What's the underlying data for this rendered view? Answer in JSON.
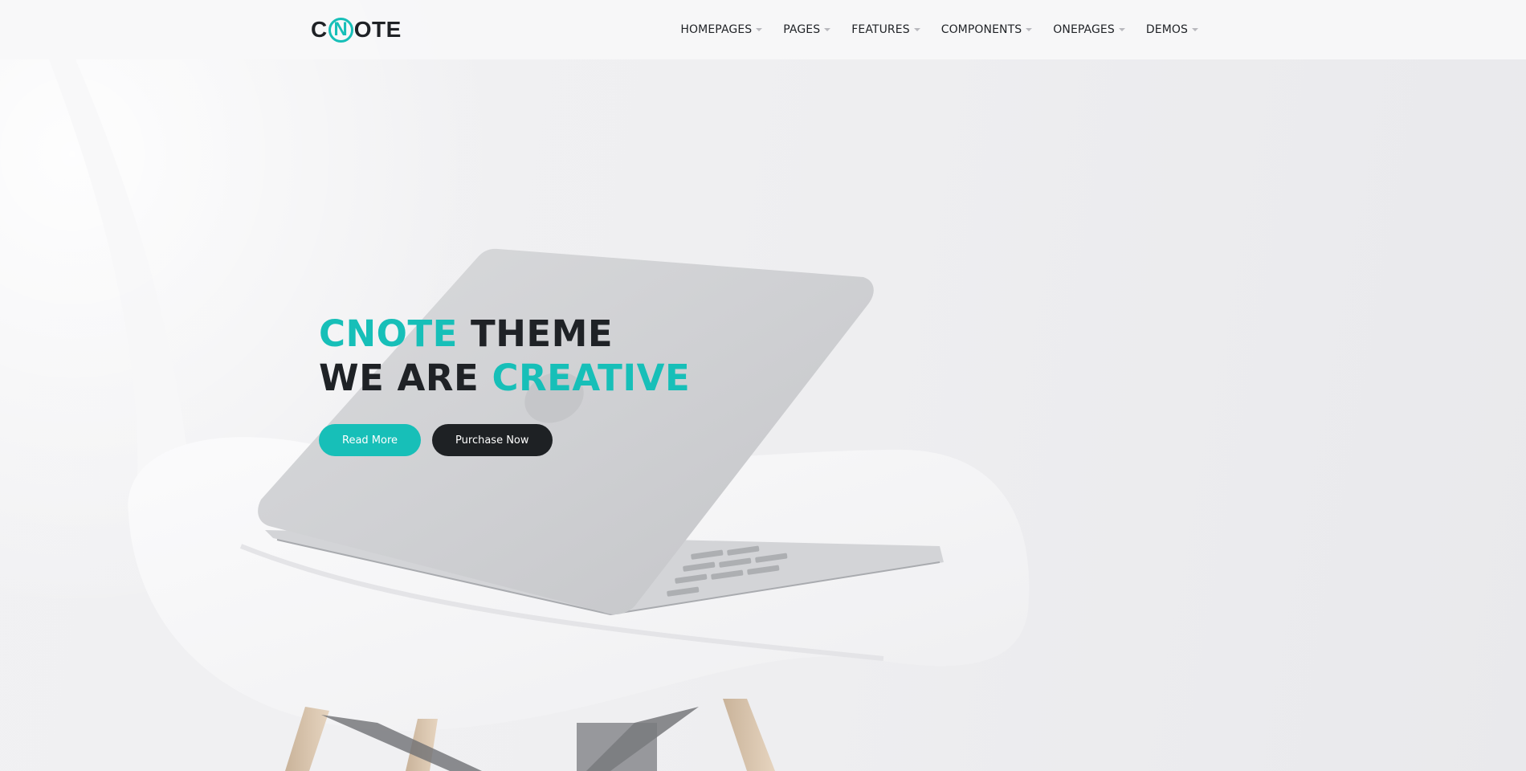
{
  "colors": {
    "accent": "#17bfb8",
    "dark": "#1f2226",
    "header_bg": "#f6f6f8"
  },
  "logo": {
    "part1": "C",
    "part2": "N",
    "part3": "OTE"
  },
  "nav": {
    "items": [
      {
        "label": "HOMEPAGES",
        "icon": "chevron-down-icon"
      },
      {
        "label": "PAGES",
        "icon": "chevron-down-icon"
      },
      {
        "label": "FEATURES",
        "icon": "chevron-down-icon"
      },
      {
        "label": "COMPONENTS",
        "icon": "chevron-down-icon"
      },
      {
        "label": "ONEPAGES",
        "icon": "chevron-down-icon"
      },
      {
        "label": "DEMOS",
        "icon": "chevron-down-icon"
      }
    ]
  },
  "hero": {
    "line1_accent": "CNOTE",
    "line1_rest": " THEME",
    "line2_lead": "WE ARE ",
    "line2_accent": "CREATIVE",
    "buttons": {
      "read_more": "Read More",
      "purchase": "Purchase Now"
    },
    "background_image": "white chair with silver laptop"
  }
}
